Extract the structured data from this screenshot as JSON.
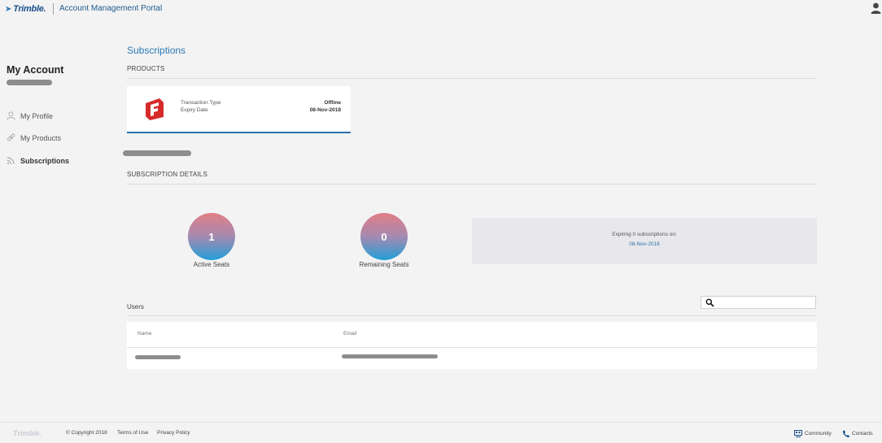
{
  "header": {
    "brand": "Trimble.",
    "portal_title": "Account Management Portal"
  },
  "sidebar": {
    "heading": "My Account",
    "items": [
      {
        "label": "My Profile",
        "icon": "person-icon"
      },
      {
        "label": "My Products",
        "icon": "link-icon"
      },
      {
        "label": "Subscriptions",
        "icon": "rss-icon",
        "active": true
      }
    ]
  },
  "main": {
    "title": "Subscriptions",
    "products_label": "PRODUCTS",
    "product_card": {
      "label_1": "Transaction Type",
      "label_2": "Expiry Date",
      "value_1": "Offline",
      "value_2": "08-Nov-2018"
    },
    "subscription_details_label": "SUBSCRIPTION DETAILS",
    "active_seats": {
      "value": "1",
      "label": "Active Seats"
    },
    "remaining_seats": {
      "value": "0",
      "label": "Remaining Seats"
    },
    "expiring": {
      "text": "Expiring 0 subscriptions on:",
      "date": "08-Nov-2018"
    },
    "users": {
      "label": "Users",
      "search_placeholder": "",
      "columns": [
        "Name",
        "Email"
      ]
    }
  },
  "footer": {
    "brand": "Trimble.",
    "copyright": "© Copyright 2018",
    "terms": "Terms of Use",
    "privacy": "Privacy Policy",
    "community": "Community",
    "contacts": "Contacts"
  },
  "colors": {
    "accent": "#2a79b5",
    "gradient_top": "#e17f86",
    "gradient_bottom": "#229fd8",
    "product_logo": "#d72b2b"
  }
}
